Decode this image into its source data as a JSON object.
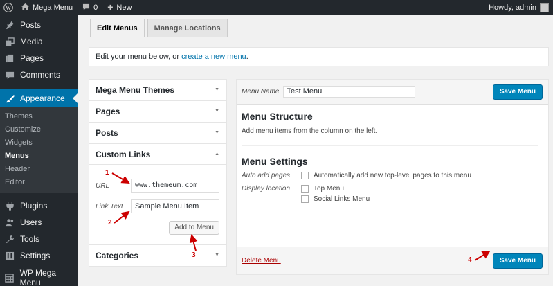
{
  "admin_bar": {
    "site_name": "Mega Menu",
    "comments_count": "0",
    "new_label": "New",
    "howdy": "Howdy, admin"
  },
  "sidebar": {
    "items": [
      {
        "label": "Posts",
        "icon": "pin-icon"
      },
      {
        "label": "Media",
        "icon": "media-icon"
      },
      {
        "label": "Pages",
        "icon": "pages-icon"
      },
      {
        "label": "Comments",
        "icon": "comments-icon"
      },
      {
        "label": "Appearance",
        "icon": "brush-icon"
      },
      {
        "label": "Plugins",
        "icon": "plug-icon"
      },
      {
        "label": "Users",
        "icon": "users-icon"
      },
      {
        "label": "Tools",
        "icon": "wrench-icon"
      },
      {
        "label": "Settings",
        "icon": "settings-icon"
      },
      {
        "label": "WP Mega Menu",
        "icon": "grid-icon"
      }
    ],
    "submenu": [
      "Themes",
      "Customize",
      "Widgets",
      "Menus",
      "Header",
      "Editor"
    ]
  },
  "tabs": {
    "edit_menus": "Edit Menus",
    "manage_locations": "Manage Locations"
  },
  "notice": {
    "text": "Edit your menu below, or ",
    "link": "create a new menu",
    "suffix": "."
  },
  "accordion": {
    "sections": [
      "Mega Menu Themes",
      "Pages",
      "Posts",
      "Custom Links",
      "Categories"
    ],
    "url_label": "URL",
    "url_value": "www.themeum.com",
    "link_text_label": "Link Text",
    "link_text_value": "Sample Menu Item",
    "add_button": "Add to Menu"
  },
  "menu_panel": {
    "name_label": "Menu Name",
    "name_value": "Test Menu",
    "save_label": "Save Menu",
    "structure_title": "Menu Structure",
    "structure_desc": "Add menu items from the column on the left.",
    "settings_title": "Menu Settings",
    "auto_add_label": "Auto add pages",
    "auto_add_option": "Automatically add new top-level pages to this menu",
    "display_location_label": "Display location",
    "locations": [
      "Top Menu",
      "Social Links Menu"
    ],
    "delete_label": "Delete Menu"
  },
  "annotations": [
    "1",
    "2",
    "3",
    "4"
  ],
  "colors": {
    "accent": "#0073aa",
    "primary_button": "#0085ba",
    "annotation": "#cc0000",
    "admin_dark": "#23282d"
  }
}
